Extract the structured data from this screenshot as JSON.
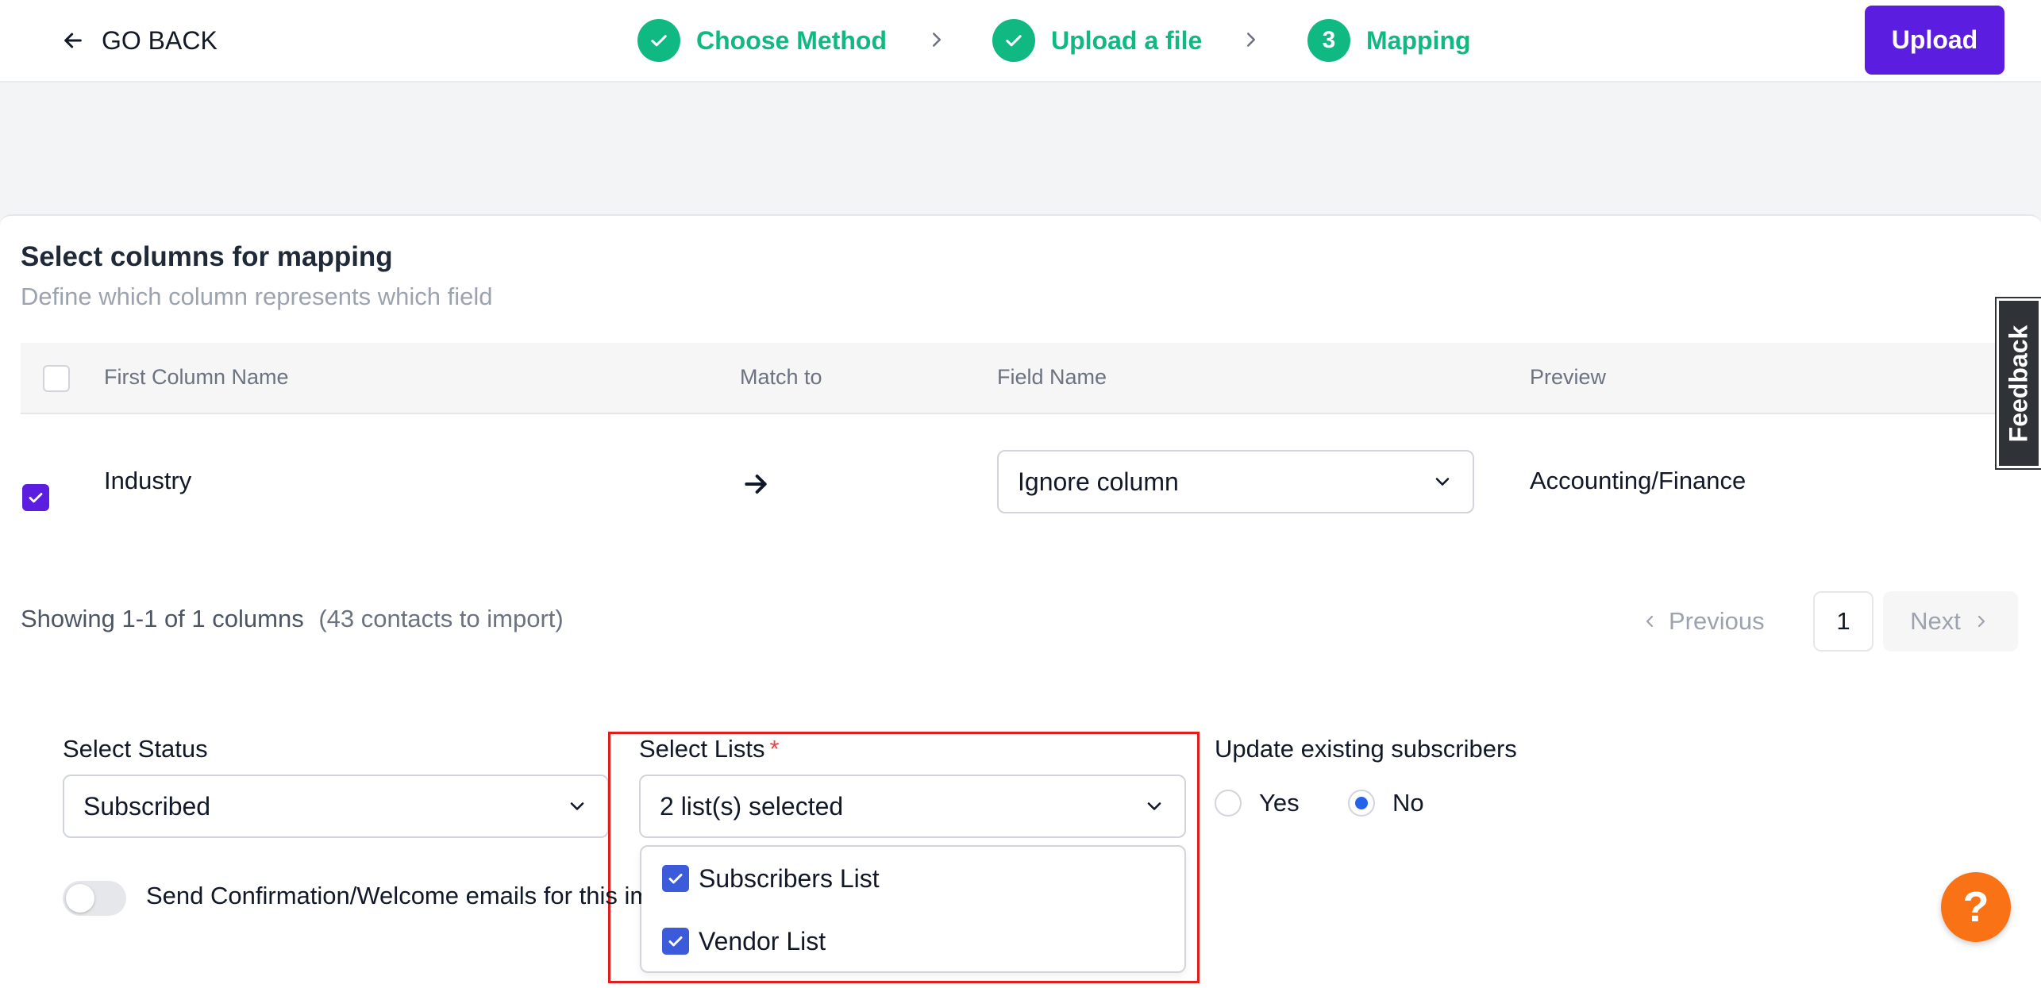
{
  "header": {
    "go_back_label": "GO BACK",
    "upload_label": "Upload",
    "steps": [
      {
        "label": "Choose Method",
        "state": "done"
      },
      {
        "label": "Upload a file",
        "state": "done"
      },
      {
        "label": "Mapping",
        "number": "3",
        "state": "current"
      }
    ]
  },
  "mapping": {
    "title": "Select columns for mapping",
    "subtitle": "Define which column represents which field",
    "columns": {
      "first_column_name": "First Column Name",
      "match_to": "Match to",
      "field_name": "Field Name",
      "preview": "Preview"
    },
    "rows": [
      {
        "checked": true,
        "column": "Industry",
        "field": "Ignore column",
        "preview": "Accounting/Finance"
      }
    ]
  },
  "pagination": {
    "showing": "Showing 1-1 of 1 columns",
    "contacts": "(43 contacts to import)",
    "previous": "Previous",
    "page": "1",
    "next": "Next"
  },
  "form": {
    "status_label": "Select Status",
    "status_value": "Subscribed",
    "lists_label": "Select Lists",
    "lists_required_mark": "*",
    "lists_value": "2 list(s) selected",
    "lists_options": [
      {
        "label": "Subscribers List",
        "checked": true
      },
      {
        "label": "Vendor List",
        "checked": true
      }
    ],
    "update_label": "Update existing subscribers",
    "update_yes": "Yes",
    "update_no": "No",
    "update_selected": "No",
    "send_confirmation_label": "Send Confirmation/Welcome emails for this import",
    "send_confirmation_enabled": false
  },
  "feedback_label": "Feedback",
  "help_label": "?",
  "colors": {
    "brand": "#5b1ee0",
    "success": "#10b981",
    "highlight": "#e11d1d",
    "help": "#f97316"
  }
}
